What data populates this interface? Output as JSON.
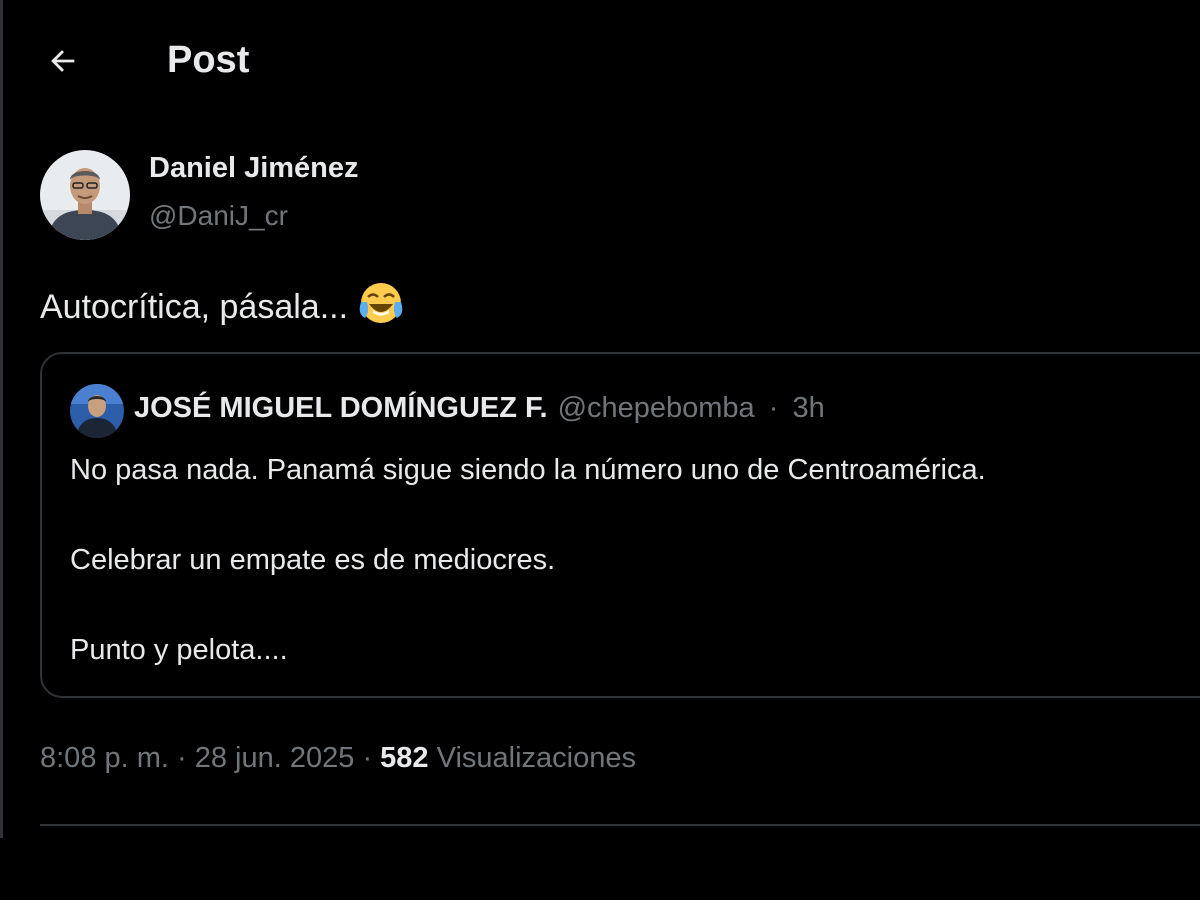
{
  "header": {
    "back_icon": "arrow-left-icon",
    "title": "Post"
  },
  "post": {
    "author_name": "Daniel Jiménez",
    "author_handle": "@DaniJ_cr",
    "text": "Autocrítica, pásala...",
    "emoji": "😂",
    "emoji_name": "face-with-tears-of-joy-icon",
    "timestamp": "8:08 p. m. · 28 jun. 2025",
    "separator": "·",
    "views_count": "582",
    "views_label": "Visualizaciones"
  },
  "quoted_post": {
    "author_name": "JOSÉ MIGUEL DOMÍNGUEZ F.",
    "author_handle": "@chepebomba",
    "separator": "·",
    "time_ago": "3h",
    "lines": [
      "No pasa nada. Panamá sigue siendo la número uno de Centroamérica.",
      "Celebrar un empate es de mediocres.",
      "Punto y pelota...."
    ]
  },
  "colors": {
    "background": "#000000",
    "primary_text": "#e7e9ea",
    "secondary_text": "#71767b",
    "border": "#2f3336"
  }
}
